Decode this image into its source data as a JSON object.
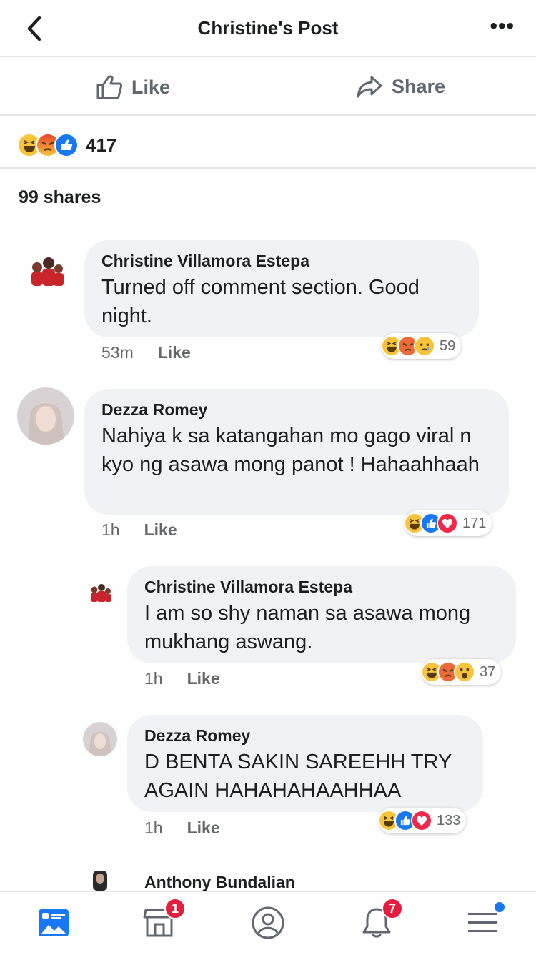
{
  "header": {
    "title": "Christine's Post",
    "back_icon": "chevron-left-icon",
    "more_label": "•••"
  },
  "actions": {
    "like_label": "Like",
    "share_label": "Share"
  },
  "post_reactions": {
    "count": "417",
    "types": [
      "haha",
      "angry",
      "like"
    ]
  },
  "shares": "99 shares",
  "comments": [
    {
      "name": "Christine Villamora Estepa",
      "text": "Turned off comment section. Good night.",
      "time": "53m",
      "like_label": "Like",
      "reaction_count": "59",
      "reactions": [
        "haha",
        "angry",
        "sad"
      ]
    },
    {
      "name": "Dezza Romey",
      "text": "Nahiya k sa katangahan mo gago viral n kyo ng asawa mong panot ! Hahaahhaah",
      "time": "1h",
      "like_label": "Like",
      "reaction_count": "171",
      "reactions": [
        "haha",
        "like",
        "love"
      ]
    },
    {
      "name": "Christine Villamora Estepa",
      "text": "I am so shy naman sa asawa mong mukhang aswang.",
      "time": "1h",
      "like_label": "Like",
      "reaction_count": "37",
      "reactions": [
        "haha",
        "angry",
        "wow"
      ]
    },
    {
      "name": "Dezza Romey",
      "text": "D BENTA SAKIN SAREEHH TRY AGAIN HAHAHAHAAHHAA",
      "time": "1h",
      "like_label": "Like",
      "reaction_count": "133",
      "reactions": [
        "haha",
        "like",
        "love"
      ]
    },
    {
      "name": "Anthony Bundalian"
    }
  ],
  "bottom_nav": {
    "items": [
      "news-feed-icon",
      "marketplace-icon",
      "profile-icon",
      "notifications-icon",
      "menu-icon"
    ],
    "marketplace_badge": "1",
    "notifications_badge": "7"
  },
  "colors": {
    "accent": "#1877f2",
    "badge": "#e41e3f",
    "bubble": "#f0f2f5"
  }
}
